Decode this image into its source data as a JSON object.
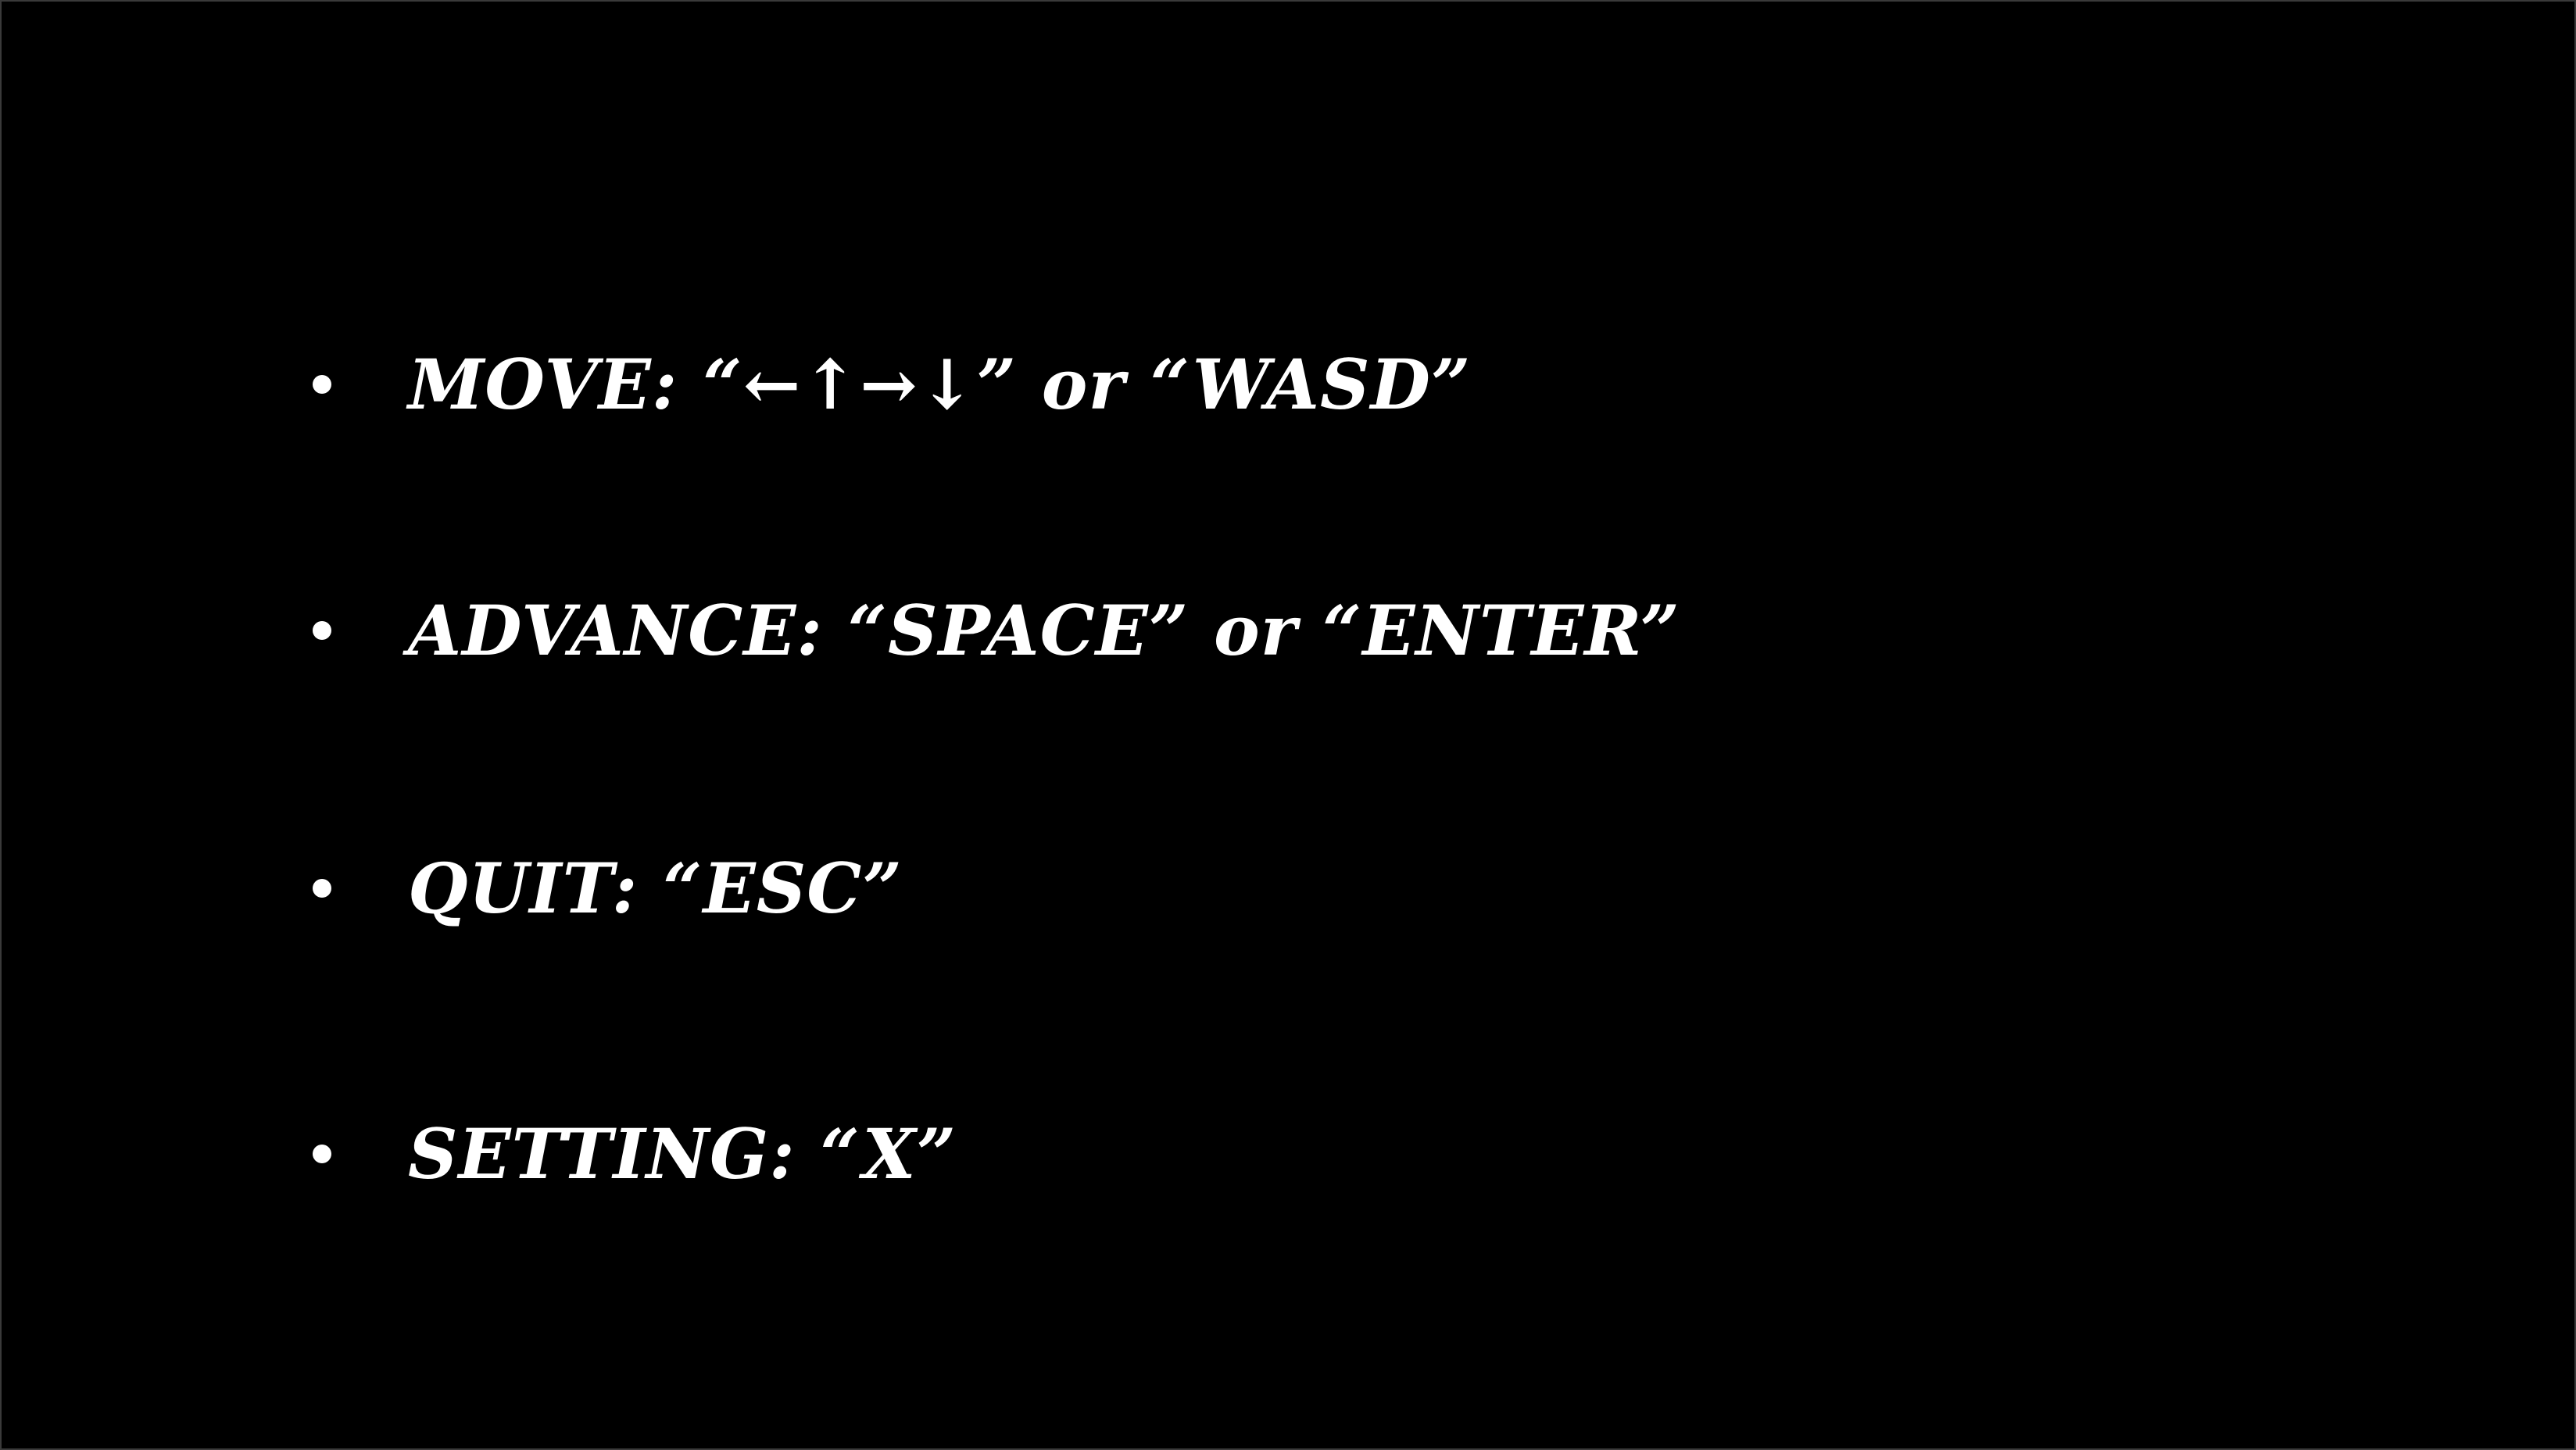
{
  "screen": {
    "background_color": "#000000",
    "text_color": "#ffffff"
  },
  "controls": [
    {
      "label": "MOVE: “←↑→↓” or “WASD”"
    },
    {
      "label": "ADVANCE: “SPACE” or “ENTER”"
    },
    {
      "label": "QUIT: “ESC”"
    },
    {
      "label": "SETTING: “X”"
    }
  ]
}
